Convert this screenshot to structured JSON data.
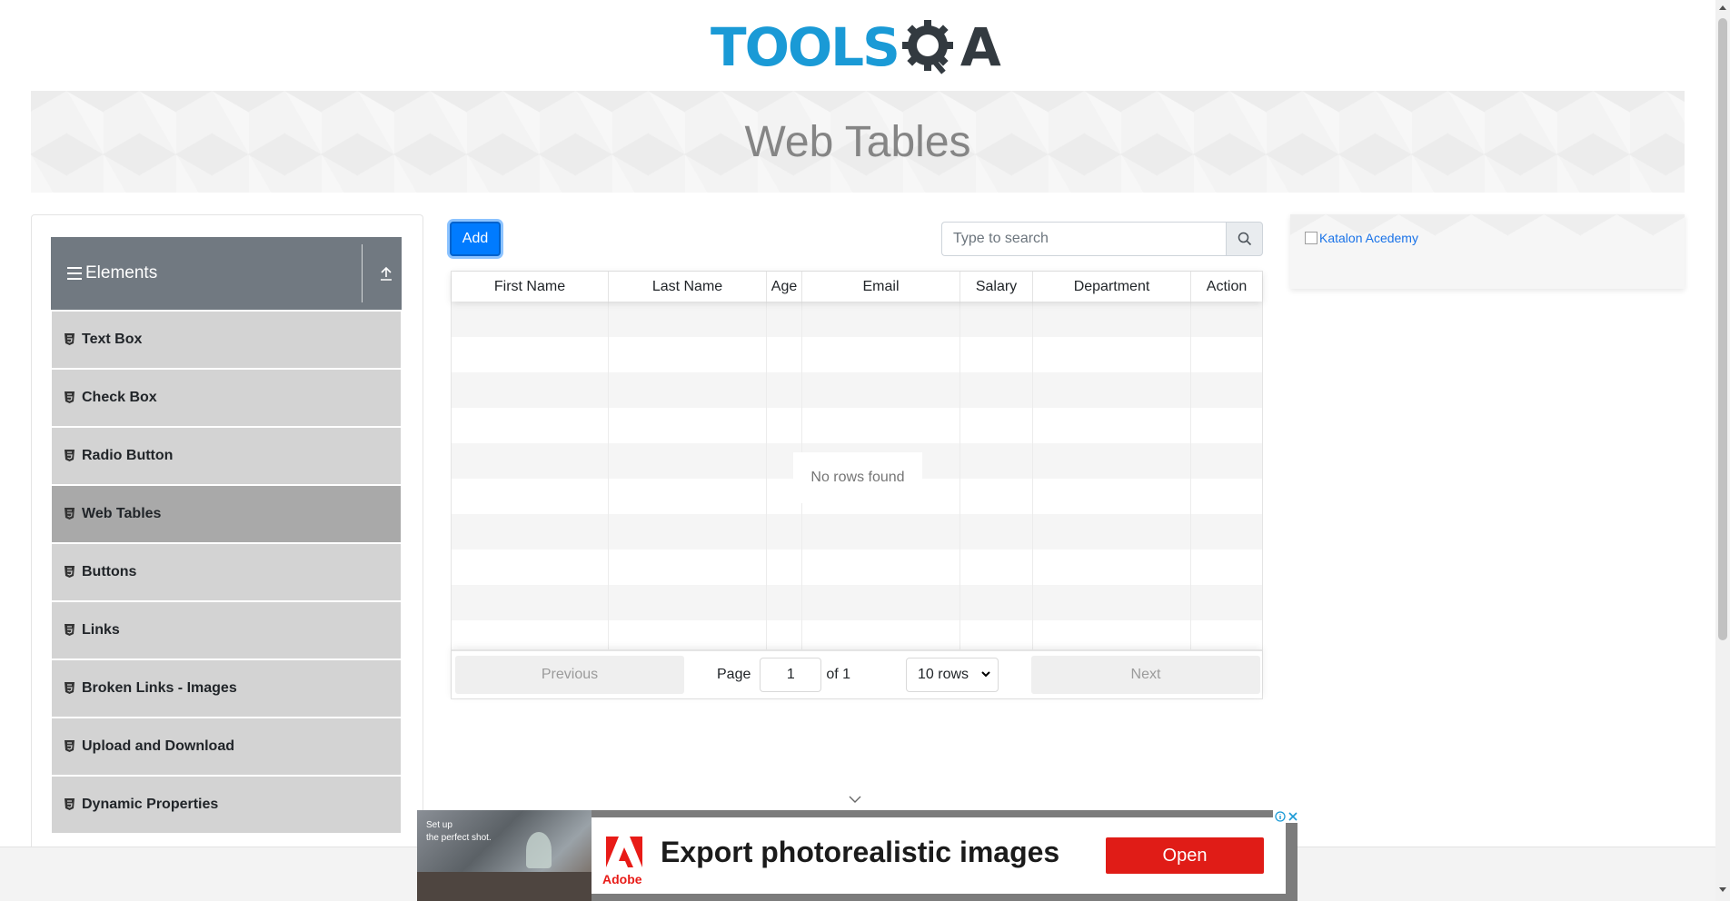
{
  "header": {
    "logo_left": "TOOLS",
    "logo_right": "A"
  },
  "banner": {
    "title": "Web Tables"
  },
  "sidebar": {
    "group_title": "Elements",
    "items": [
      {
        "label": "Text Box",
        "active": false
      },
      {
        "label": "Check Box",
        "active": false
      },
      {
        "label": "Radio Button",
        "active": false
      },
      {
        "label": "Web Tables",
        "active": true
      },
      {
        "label": "Buttons",
        "active": false
      },
      {
        "label": "Links",
        "active": false
      },
      {
        "label": "Broken Links - Images",
        "active": false
      },
      {
        "label": "Upload and Download",
        "active": false
      },
      {
        "label": "Dynamic Properties",
        "active": false
      }
    ]
  },
  "toolbar": {
    "add_label": "Add",
    "search_placeholder": "Type to search",
    "search_icon": "search-icon"
  },
  "table": {
    "columns": [
      "First Name",
      "Last Name",
      "Age",
      "Email",
      "Salary",
      "Department",
      "Action"
    ],
    "empty_message": "No rows found",
    "row_count": 10
  },
  "pagination": {
    "previous_label": "Previous",
    "page_label": "Page",
    "current_page": "1",
    "of_label": "of 1",
    "rows_selected": "10 rows",
    "next_label": "Next"
  },
  "side_ad": {
    "alt_text": "Katalon Acedemy"
  },
  "bottom_ad": {
    "photo_caption_line1": "Set up",
    "photo_caption_line2": "the perfect shot.",
    "brand": "Adobe",
    "headline": "Export photorealistic images",
    "cta": "Open"
  },
  "colors": {
    "primary": "#007bff",
    "sidebar_header": "#717981",
    "menu_item": "#d3d3d3",
    "menu_active": "#a9a9a9",
    "ad_cta": "#e01c17"
  }
}
